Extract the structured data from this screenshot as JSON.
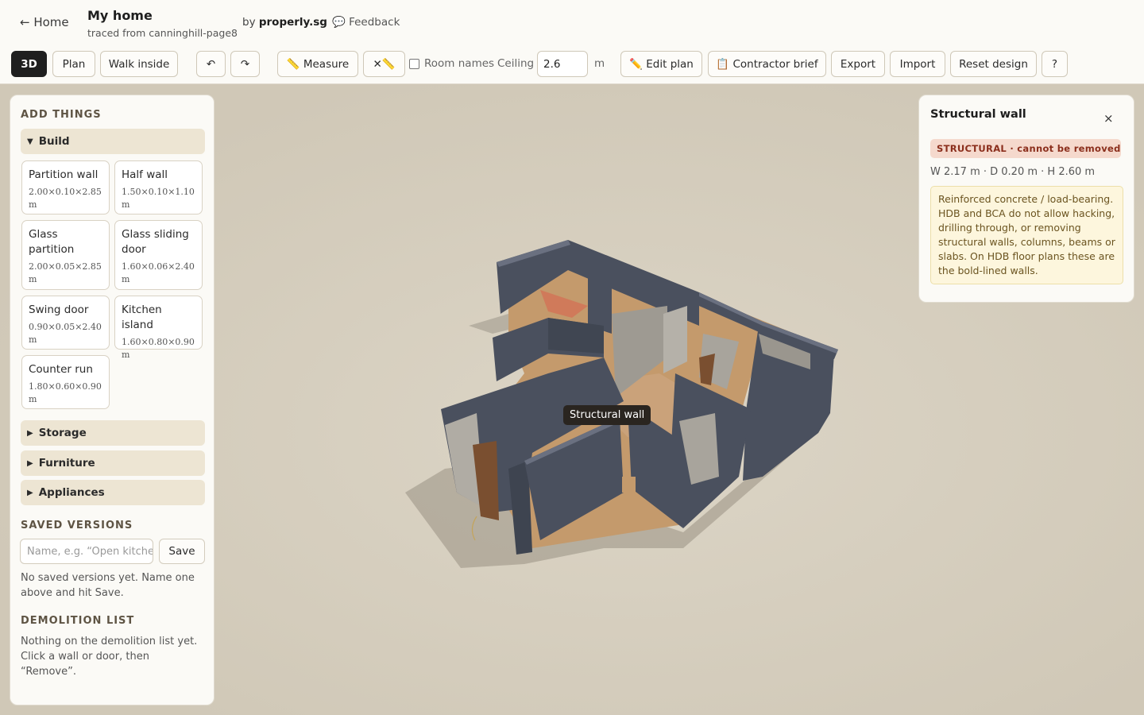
{
  "header": {
    "home": "← Home",
    "title": "My home",
    "subtitle": "traced from canninghill-page8",
    "by_prefix": "by",
    "brand": "properly.sg",
    "feedback": "💬 Feedback"
  },
  "toolbar": {
    "view_3d": "3D",
    "view_plan": "Plan",
    "walk_inside": "Walk inside",
    "undo": "↶",
    "redo": "↷",
    "measure": "📏 Measure",
    "clear_measure": "✕📏",
    "room_names": "Room names",
    "room_names_checked": false,
    "ceiling_label": "Ceiling",
    "ceiling_value": "2.6",
    "ceiling_unit": "m",
    "edit_plan": "✏️ Edit plan",
    "contractor_brief": "📋 Contractor brief",
    "export": "Export",
    "import": "Import",
    "reset": "Reset design",
    "help": "?"
  },
  "left": {
    "add_things": "ADD THINGS",
    "build": "Build",
    "items": [
      {
        "name": "Partition wall",
        "dims": "2.00×0.10×2.85 m"
      },
      {
        "name": "Half wall",
        "dims": "1.50×0.10×1.10 m"
      },
      {
        "name": "Glass partition",
        "dims": "2.00×0.05×2.85 m"
      },
      {
        "name": "Glass sliding door",
        "dims": "1.60×0.06×2.40 m"
      },
      {
        "name": "Swing door",
        "dims": "0.90×0.05×2.40 m"
      },
      {
        "name": "Kitchen island",
        "dims": "1.60×0.80×0.90 m"
      },
      {
        "name": "Counter run",
        "dims": "1.80×0.60×0.90 m"
      }
    ],
    "storage": "Storage",
    "furniture": "Furniture",
    "appliances": "Appliances",
    "saved_versions": "SAVED VERSIONS",
    "save_placeholder": "Name, e.g. “Open kitchen”",
    "save": "Save",
    "no_saved": "No saved versions yet. Name one above and hit Save.",
    "demolition_list": "DEMOLITION LIST",
    "demolition_empty": "Nothing on the demolition list yet. Click a wall or door, then “Remove”."
  },
  "viewport": {
    "tooltip": "Structural wall"
  },
  "inspector": {
    "title": "Structural wall",
    "close": "×",
    "badge": "STRUCTURAL · cannot be removed",
    "dims": "W 2.17 m · D 0.20 m · H 2.60 m",
    "note": "Reinforced concrete / load-bearing. HDB and BCA do not allow hacking, drilling through, or removing structural walls, columns, beams or slabs. On HDB floor plans these are the bold-lined walls."
  },
  "colors": {
    "wall": "#4a505e",
    "floor": "#c49a6c",
    "accent_structural": "#8b2e1c",
    "canvas_bg": "#d0c8b7"
  }
}
